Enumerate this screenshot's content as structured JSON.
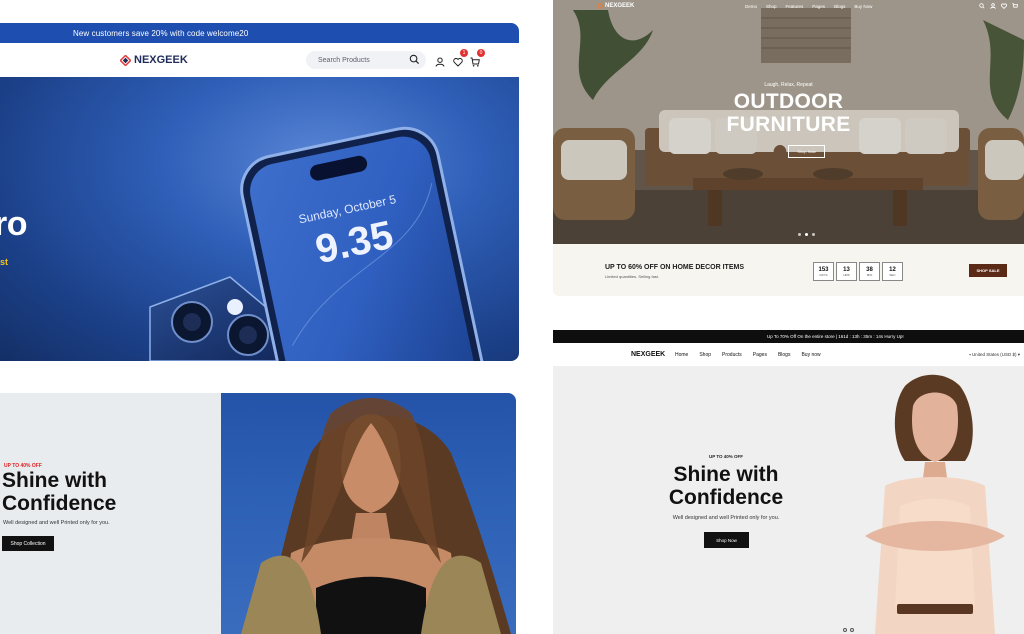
{
  "electronics": {
    "promo_text": "New customers save 20% with code welcome20",
    "logo_text": "NEXGEEK",
    "search_placeholder": "Search Products",
    "wishlist_count": "1",
    "cart_count": "0",
    "phone_date": "Sunday, October 5",
    "phone_time": "9.35",
    "hero_title_fragment": "ro",
    "hero_accent_fragment": "st",
    "brand_color": "#1d4eb0"
  },
  "furniture": {
    "logo_text": "NEXGEEK",
    "nav": [
      "Demo",
      "Shop",
      "Features",
      "Pages",
      "Blogs",
      "Buy Now"
    ],
    "tagline": "Laugh, Relax, Repeat",
    "title_line1": "OUTDOOR",
    "title_line2": "FURNITURE",
    "hero_button": "Shop Now",
    "sale_title": "UP TO 60% OFF ON HOME DECOR ITEMS",
    "sale_subtitle": "Limited quantities. Selling fast.",
    "countdown": [
      {
        "value": "153",
        "unit": "DAYS"
      },
      {
        "value": "13",
        "unit": "HRS"
      },
      {
        "value": "38",
        "unit": "MIN"
      },
      {
        "value": "12",
        "unit": "SEC"
      }
    ],
    "sale_button": "SHOP SALE",
    "sale_button_color": "#5b2a17"
  },
  "fashion_a": {
    "eyebrow": "UP TO 40% OFF",
    "title_line1": "Shine with",
    "title_line2": "Confidence",
    "subtitle": "Well designed and well Printed only for you.",
    "button": "Shop Collection"
  },
  "fashion_b": {
    "announcement": "Up To 70% Off On the entire store  |  161d : 13h : 35m : 14s  Hurry Up!",
    "logo_text": "NEXGEEK",
    "nav": [
      "Home",
      "Shop",
      "Products",
      "Pages",
      "Blogs",
      "Buy now"
    ],
    "locale": "United States (USD $)",
    "eyebrow": "UP TO 40% OFF",
    "title_line1": "Shine with",
    "title_line2": "Confidence",
    "subtitle": "Well designed and well Printed only for you.",
    "button": "Shop Now"
  }
}
